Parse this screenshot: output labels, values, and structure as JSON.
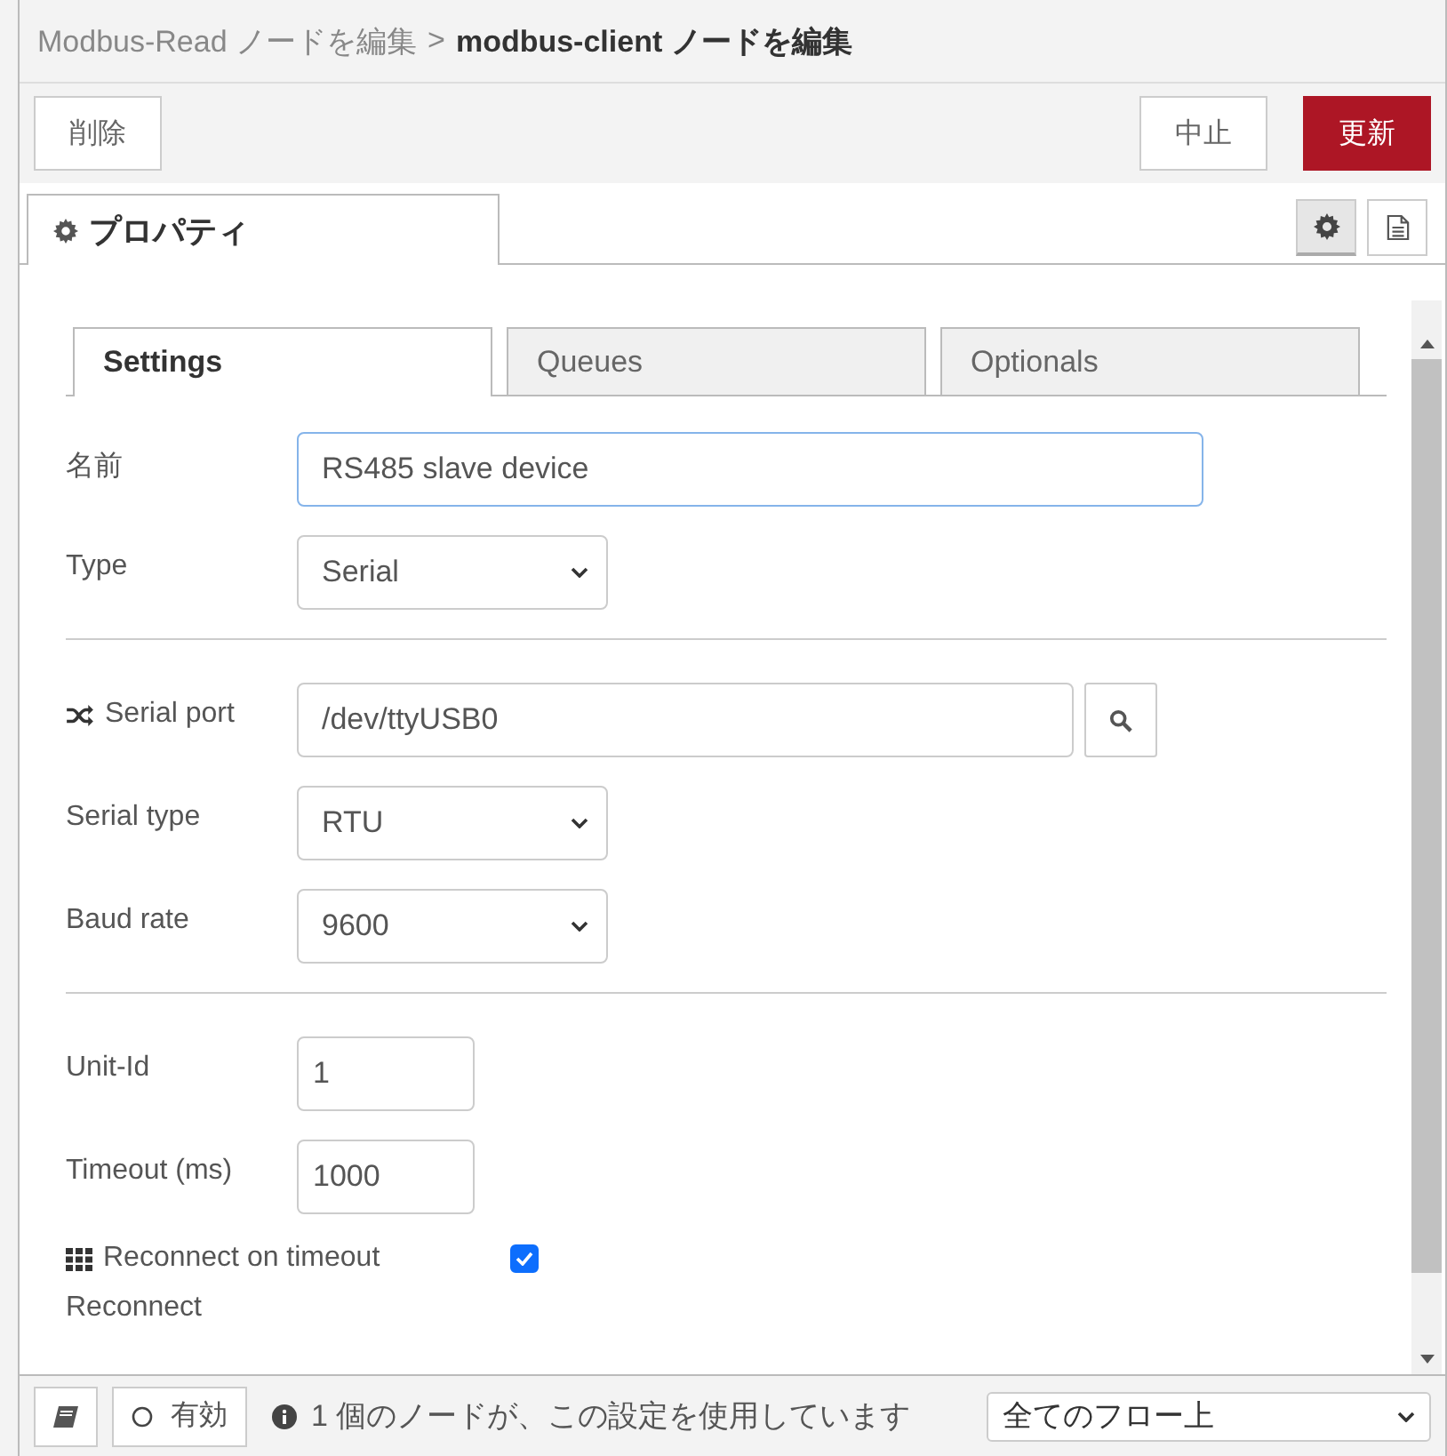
{
  "breadcrumb": {
    "parent": "Modbus-Read ノードを編集",
    "separator": ">",
    "current": "modbus-client ノードを編集"
  },
  "toolbar": {
    "delete": "削除",
    "cancel": "中止",
    "update": "更新"
  },
  "panel_tabs": [
    {
      "label": "プロパティ",
      "selected": true
    }
  ],
  "tabs": [
    {
      "label": "Settings",
      "selected": true
    },
    {
      "label": "Queues",
      "selected": false
    },
    {
      "label": "Optionals",
      "selected": false
    }
  ],
  "fields": [
    {
      "kind": "text",
      "label": "名前",
      "value": "RS485 slave device",
      "focused": true
    },
    {
      "kind": "select",
      "label": "Type",
      "value": "Serial"
    },
    {
      "kind": "divider"
    },
    {
      "kind": "port",
      "label": "Serial port",
      "value": "/dev/ttyUSB0"
    },
    {
      "kind": "select",
      "label": "Serial type",
      "value": "RTU"
    },
    {
      "kind": "select",
      "label": "Baud rate",
      "value": "9600"
    },
    {
      "kind": "divider"
    },
    {
      "kind": "number",
      "label": "Unit-Id",
      "value": "1"
    },
    {
      "kind": "number",
      "label": "Timeout (ms)",
      "value": "1000"
    },
    {
      "kind": "checkbox",
      "label": "Reconnect on timeout",
      "checked": true
    },
    {
      "kind": "label",
      "label": "Reconnect"
    }
  ],
  "footer": {
    "enabled_label": "有効",
    "info": "1 個のノードが、この設定を使用しています",
    "scope": "全てのフロー上"
  }
}
